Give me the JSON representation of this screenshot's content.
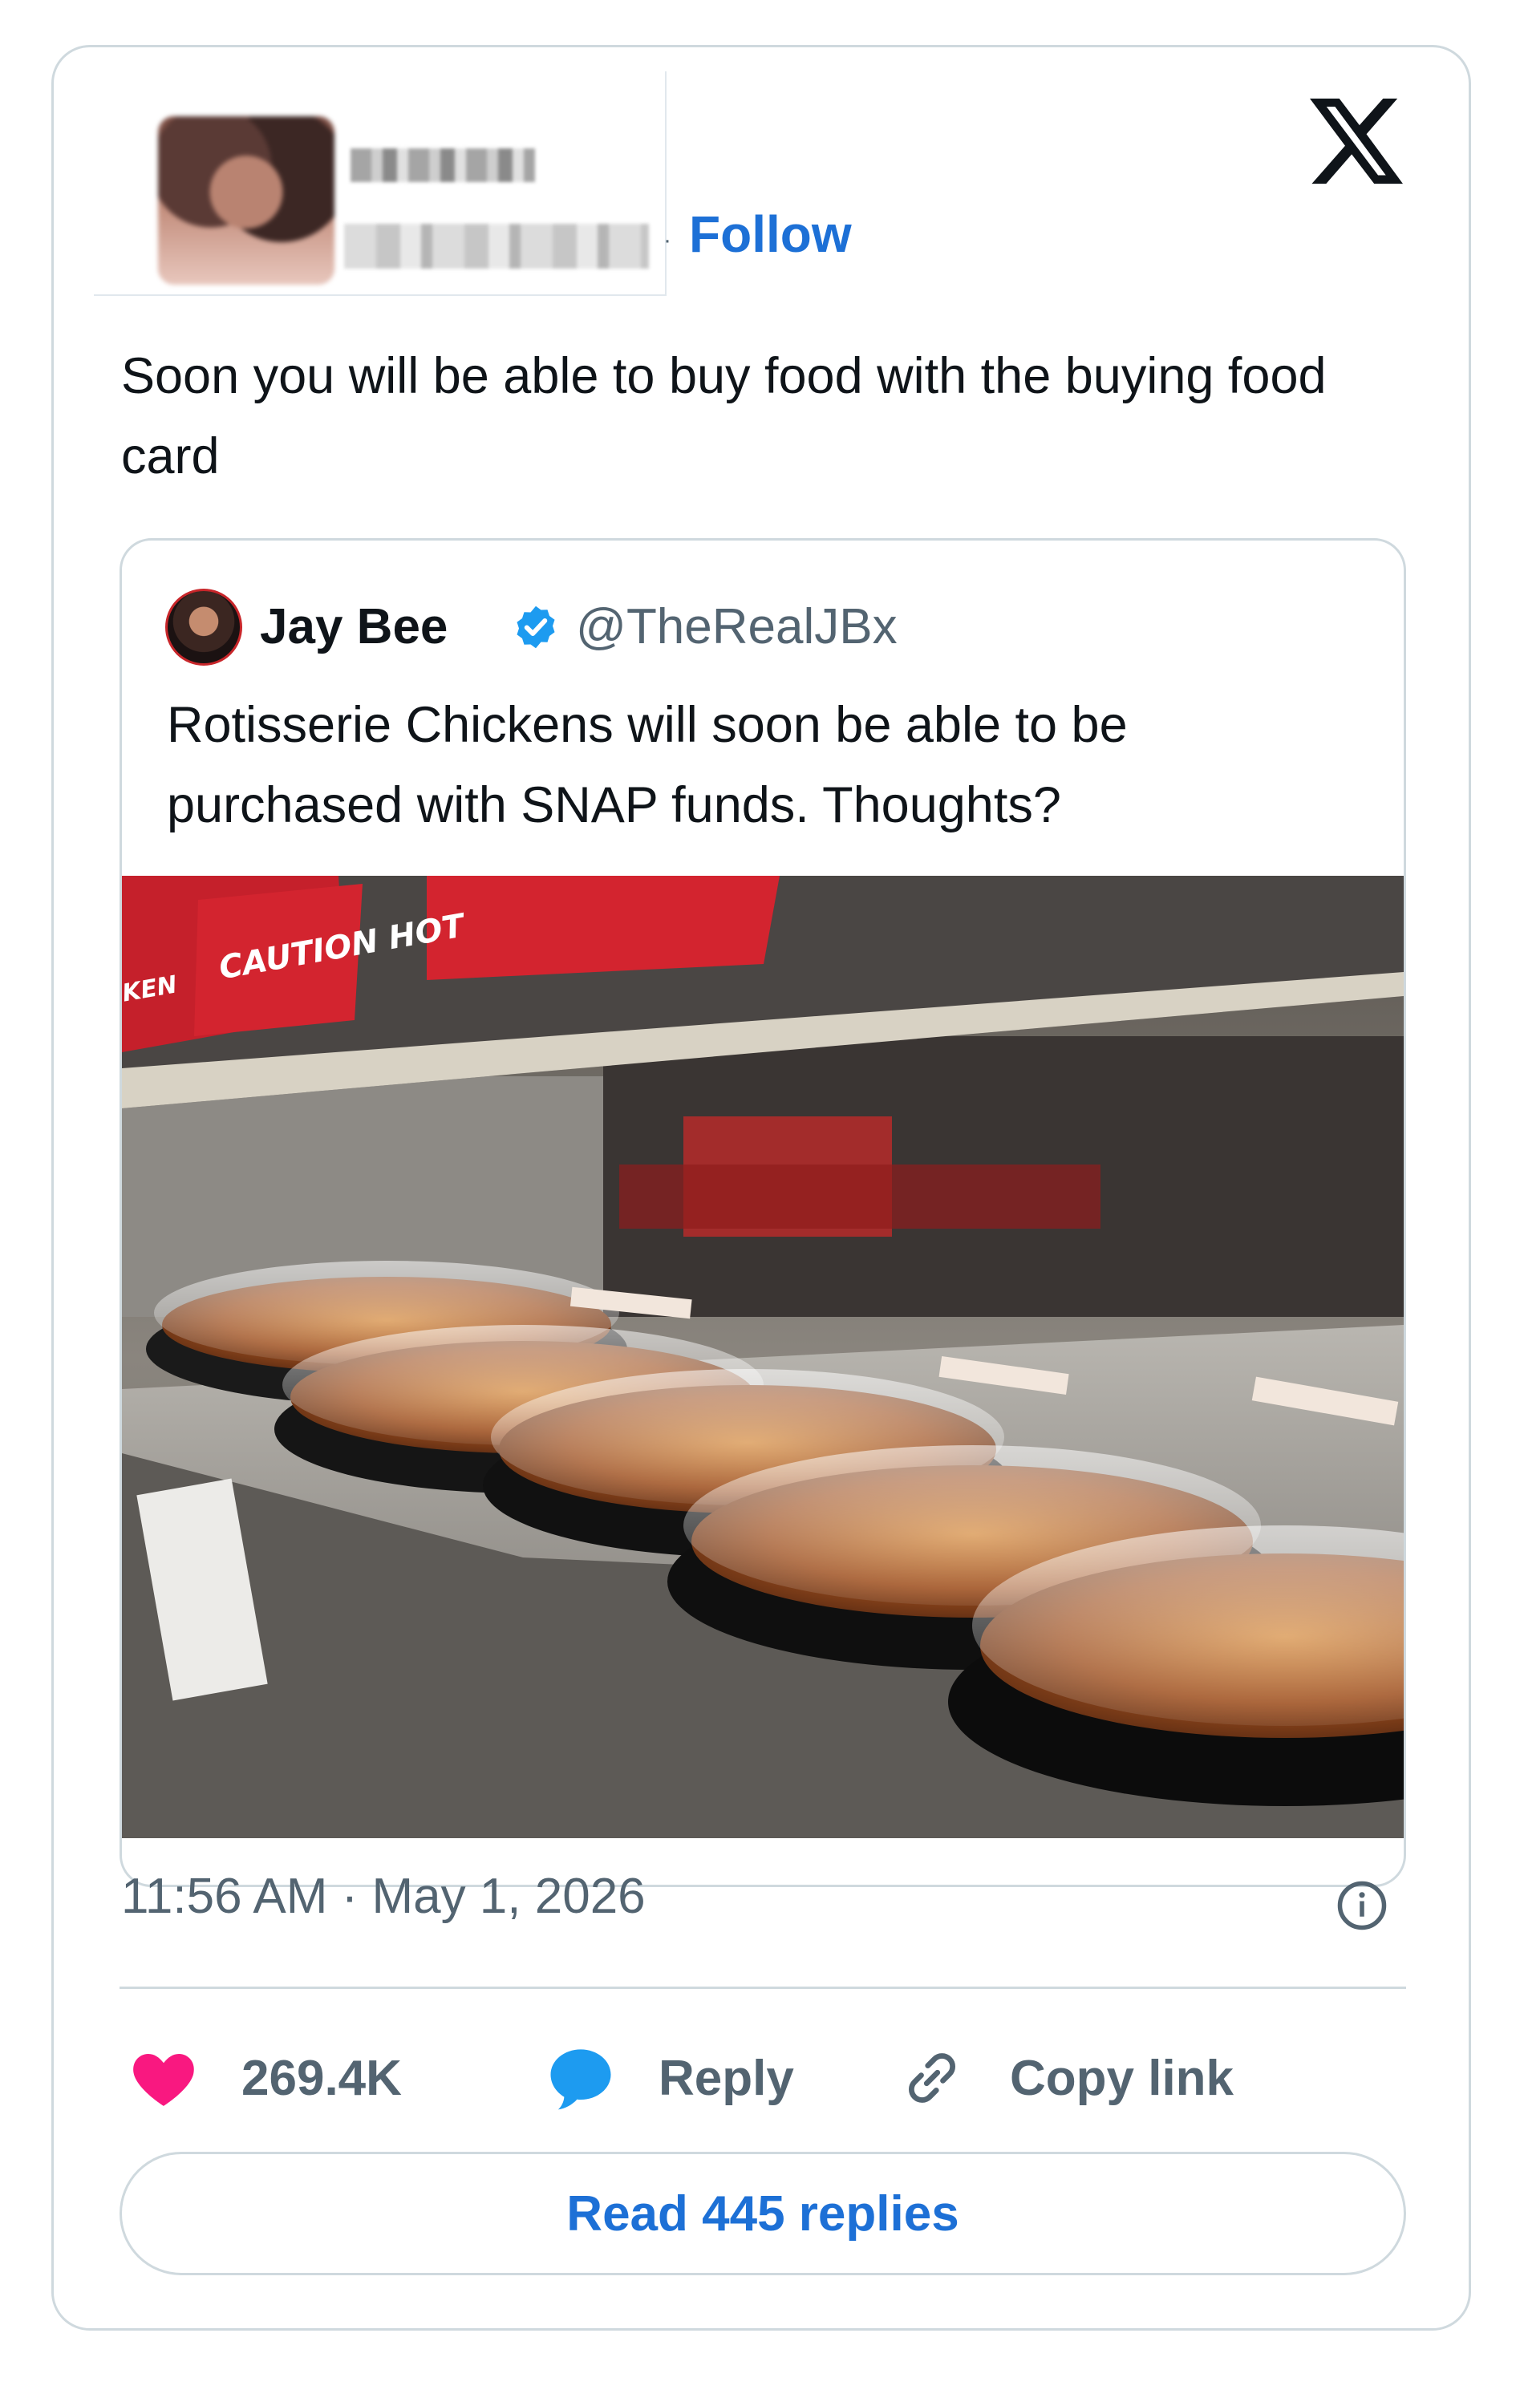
{
  "author": {
    "follow_label": "Follow",
    "separator": "·"
  },
  "tweet": {
    "text": "Soon you will be able to buy food with the buying food card",
    "timestamp": "11:56 AM · May 1, 2026"
  },
  "quoted_tweet": {
    "name": "Jay Bee",
    "handle": "@TheRealJBx",
    "verified": true,
    "text": "Rotisserie Chickens will soon be able to be purchased with SNAP funds. Thoughts?",
    "image": {
      "sign_main": "CAUTION HOT",
      "sign_left": "KEN"
    }
  },
  "actions": {
    "likes": "269.4K",
    "reply_label": "Reply",
    "copy_label": "Copy link",
    "read_replies_label": "Read 445 replies"
  },
  "colors": {
    "accent": "#1d70d6",
    "like": "#f91880",
    "reply": "#1d9bf0",
    "muted": "#536471",
    "border": "#cfd9de"
  },
  "icons": [
    "x-logo-icon",
    "verified-badge-icon",
    "info-icon",
    "heart-icon",
    "reply-bubble-icon",
    "link-icon"
  ]
}
